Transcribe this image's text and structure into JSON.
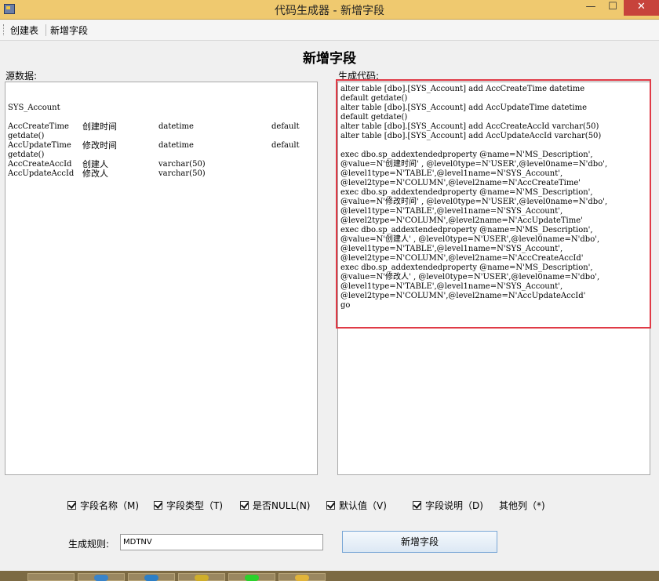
{
  "window": {
    "title": "代码生成器 - 新增字段",
    "min_label": "—",
    "max_label": "☐",
    "close_label": "✕"
  },
  "menu": {
    "create_table": "创建表",
    "add_field": "新增字段"
  },
  "main": {
    "heading": "新增字段",
    "source_label": "源数据:",
    "generated_label": "生成代码:"
  },
  "source_data": {
    "table_name": "SYS_Account",
    "rows": [
      {
        "name": "AccCreateTime",
        "desc": "创建时间",
        "type": "datetime",
        "extra": "default"
      },
      {
        "name": "getdate()",
        "desc": "",
        "type": "",
        "extra": ""
      },
      {
        "name": "AccUpdateTime",
        "desc": "修改时间",
        "type": "datetime",
        "extra": "default"
      },
      {
        "name": "getdate()",
        "desc": "",
        "type": "",
        "extra": ""
      },
      {
        "name": "AccCreateAccId",
        "desc": "创建人",
        "type": "varchar(50)",
        "extra": ""
      },
      {
        "name": "AccUpdateAccId",
        "desc": "修改人",
        "type": "varchar(50)",
        "extra": ""
      }
    ]
  },
  "generated_code": [
    "alter table [dbo].[SYS_Account] add AccCreateTime datetime",
    "default getdate()",
    "alter table [dbo].[SYS_Account] add AccUpdateTime datetime",
    "default getdate()",
    "alter table [dbo].[SYS_Account] add AccCreateAccId varchar(50)",
    "alter table [dbo].[SYS_Account] add AccUpdateAccId varchar(50)",
    "",
    "exec dbo.sp_addextendedproperty @name=N'MS_Description',",
    "@value=N'创建时间' , @level0type=N'USER',@level0name=N'dbo',",
    "@level1type=N'TABLE',@level1name=N'SYS_Account',",
    "@level2type=N'COLUMN',@level2name=N'AccCreateTime'",
    "exec dbo.sp_addextendedproperty @name=N'MS_Description',",
    "@value=N'修改时间' , @level0type=N'USER',@level0name=N'dbo',",
    "@level1type=N'TABLE',@level1name=N'SYS_Account',",
    "@level2type=N'COLUMN',@level2name=N'AccUpdateTime'",
    "exec dbo.sp_addextendedproperty @name=N'MS_Description',",
    "@value=N'创建人' , @level0type=N'USER',@level0name=N'dbo',",
    "@level1type=N'TABLE',@level1name=N'SYS_Account',",
    "@level2type=N'COLUMN',@level2name=N'AccCreateAccId'",
    "exec dbo.sp_addextendedproperty @name=N'MS_Description',",
    "@value=N'修改人' , @level0type=N'USER',@level0name=N'dbo',",
    "@level1type=N'TABLE',@level1name=N'SYS_Account',",
    "@level2type=N'COLUMN',@level2name=N'AccUpdateAccId'",
    "go"
  ],
  "options": {
    "field_name": {
      "label": "字段名称（M)",
      "checked": true
    },
    "field_type": {
      "label": "字段类型（T)",
      "checked": true
    },
    "nullable": {
      "label": "是否NULL(N)",
      "checked": true
    },
    "default_value": {
      "label": "默认值（V)",
      "checked": true
    },
    "field_desc": {
      "label": "字段说明（D)",
      "checked": true
    },
    "other_columns": "其他列（*)"
  },
  "rule": {
    "label": "生成规则:",
    "value": "MDTNV"
  },
  "add_button_label": "新增字段",
  "colors": {
    "titlebar": "#efc96f",
    "close_button": "#c7433b",
    "highlight_border": "#e03a46",
    "button_border": "#7aa7d6"
  }
}
